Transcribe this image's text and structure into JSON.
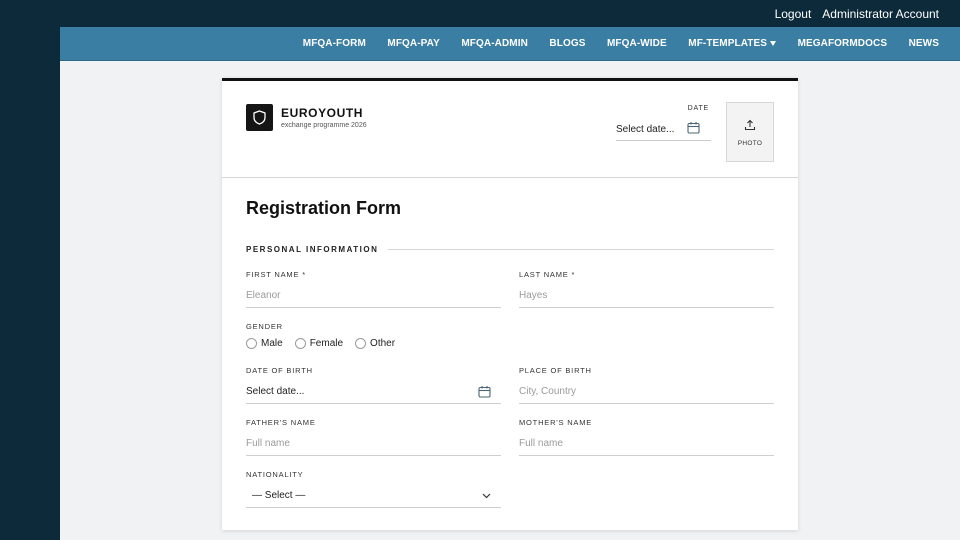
{
  "topbar": {
    "logout": "Logout",
    "account": "Administrator Account"
  },
  "nav": {
    "items": [
      {
        "label": "MFQA-FORM"
      },
      {
        "label": "MFQA-PAY"
      },
      {
        "label": "MFQA-ADMIN"
      },
      {
        "label": "BLOGS"
      },
      {
        "label": "MFQA-WIDE"
      },
      {
        "label": "MF-TEMPLATES",
        "has_dropdown": true
      },
      {
        "label": "MEGAFORMDOCS"
      },
      {
        "label": "NEWS"
      }
    ]
  },
  "brand": {
    "name": "EUROYOUTH",
    "subtitle": "exchange programme 2026",
    "logo_icon": "shield-icon"
  },
  "header_date": {
    "label": "DATE",
    "value": "Select date...",
    "icon": "calendar-icon"
  },
  "photo": {
    "label": "PHOTO",
    "icon": "upload-icon"
  },
  "form": {
    "title": "Registration Form",
    "section": "PERSONAL INFORMATION",
    "first_name": {
      "label": "FIRST NAME",
      "required": "*",
      "placeholder": "Eleanor"
    },
    "last_name": {
      "label": "LAST NAME",
      "required": "*",
      "placeholder": "Hayes"
    },
    "gender": {
      "label": "GENDER",
      "options": [
        "Male",
        "Female",
        "Other"
      ]
    },
    "dob": {
      "label": "DATE OF BIRTH",
      "value": "Select date...",
      "icon": "calendar-icon"
    },
    "pob": {
      "label": "PLACE OF BIRTH",
      "placeholder": "City, Country"
    },
    "father": {
      "label": "FATHER'S NAME",
      "placeholder": "Full name"
    },
    "mother": {
      "label": "MOTHER'S NAME",
      "placeholder": "Full name"
    },
    "nationality": {
      "label": "NATIONALITY",
      "value": "— Select —",
      "icon": "chevron-down-icon"
    }
  },
  "colors": {
    "dark_navy": "#0d2a3a",
    "nav_blue": "#3b7ea4",
    "page_bg": "#f1f2f3",
    "card_bg": "#ffffff"
  }
}
